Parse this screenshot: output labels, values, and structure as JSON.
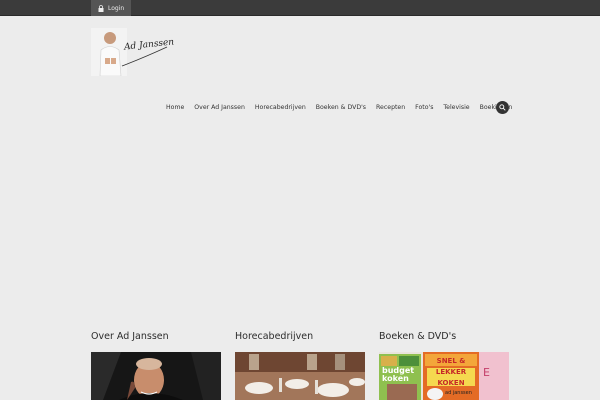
{
  "topbar": {
    "login_label": "Login",
    "icon": "lock-icon"
  },
  "logo": {
    "signature": "Ad Janssen"
  },
  "nav": {
    "items": [
      {
        "label": "Home"
      },
      {
        "label": "Over Ad Janssen"
      },
      {
        "label": "Horecabedrijven"
      },
      {
        "label": "Boeken & DVD's"
      },
      {
        "label": "Recepten"
      },
      {
        "label": "Foto's"
      },
      {
        "label": "Televisie"
      },
      {
        "label": "Boekingen"
      }
    ],
    "search_icon": "search-icon"
  },
  "columns": [
    {
      "title": "Over Ad Janssen"
    },
    {
      "title": "Horecabedrijven"
    },
    {
      "title": "Boeken & DVD's"
    }
  ],
  "books": {
    "cover1": "budget koken",
    "cover2": "SNEL & LEKKER KOKEN",
    "cover2_author": "ad janssen"
  },
  "colors": {
    "topbar": "#3b3b3b",
    "background": "#ececec",
    "accent_dark": "#333333"
  }
}
